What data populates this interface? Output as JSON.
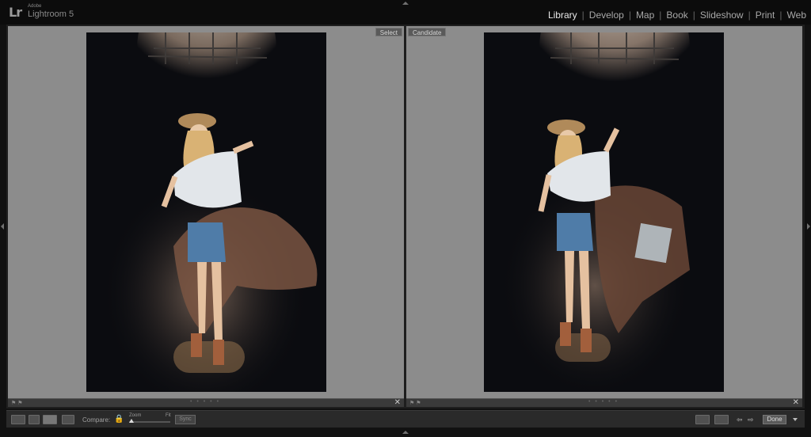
{
  "app": {
    "logo": "Lr",
    "vendor": "Adobe",
    "product": "Lightroom 5"
  },
  "modules": [
    "Library",
    "Develop",
    "Map",
    "Book",
    "Slideshow",
    "Print",
    "Web"
  ],
  "active_module": "Library",
  "compare": {
    "select_label": "Select",
    "candidate_label": "Candidate"
  },
  "toolbar": {
    "compare_label": "Compare:",
    "zoom_label": "Zoom",
    "fit_label": "Fit",
    "sync_label": "Sync",
    "done_label": "Done"
  },
  "colors": {
    "accent": "#e9e9e9",
    "panel": "#8c8c8c",
    "background": "#111111"
  }
}
